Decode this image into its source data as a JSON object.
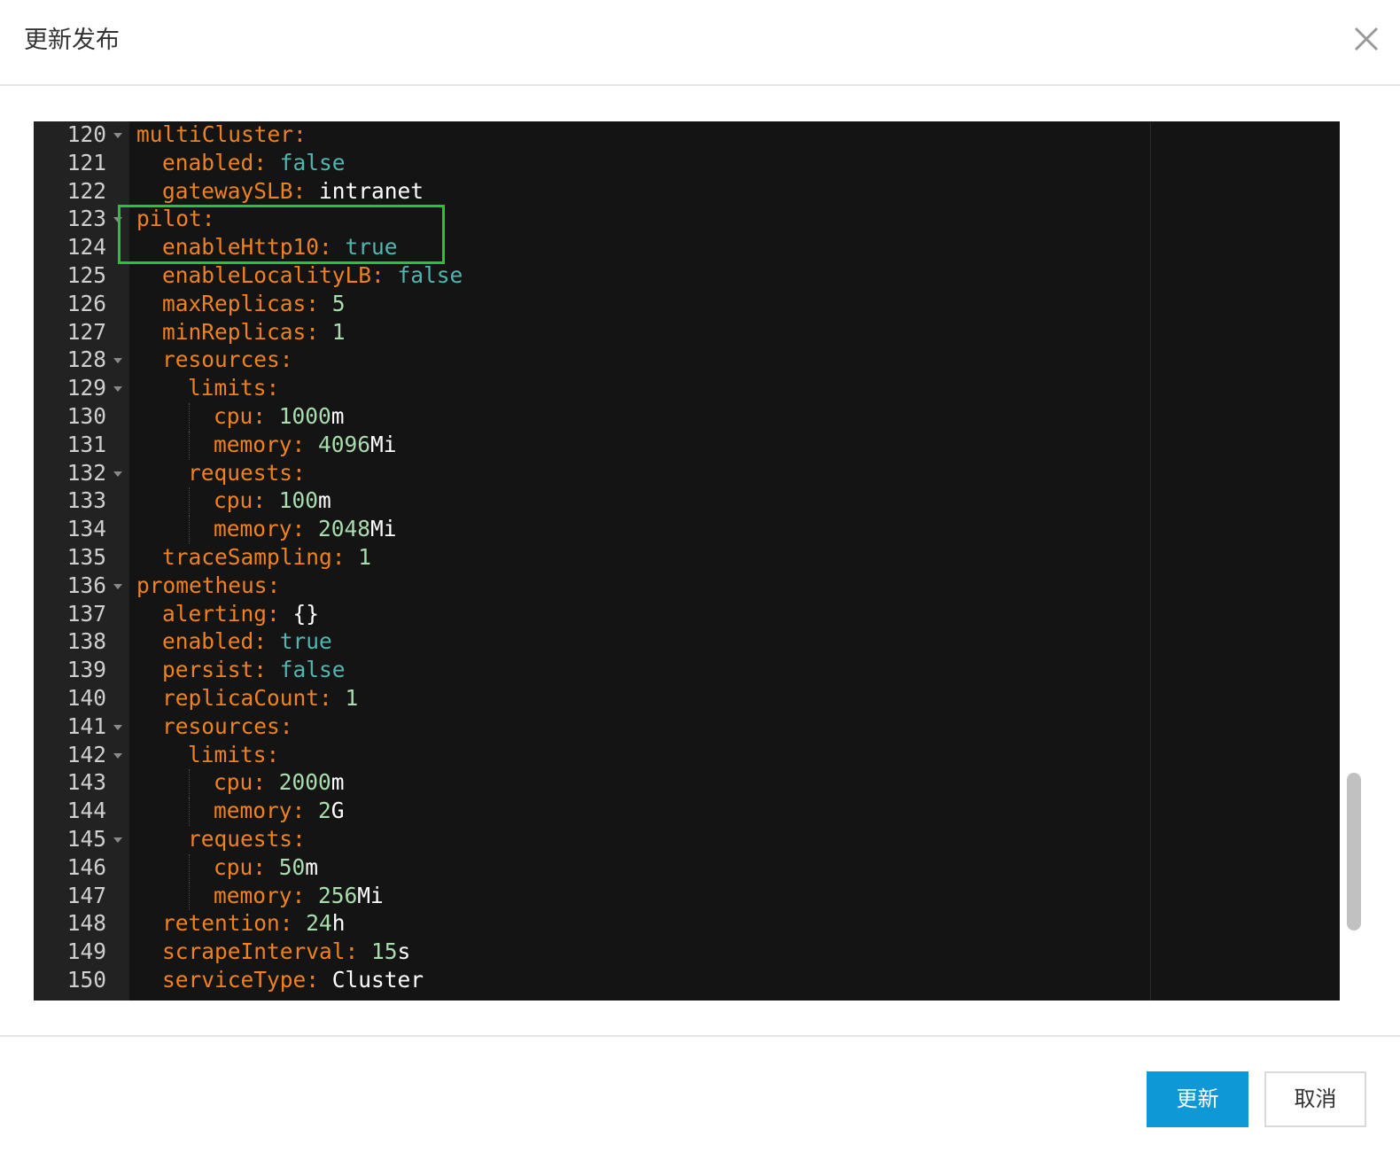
{
  "dialog": {
    "title": "更新发布",
    "close_icon": "close-icon"
  },
  "editor": {
    "lines": [
      {
        "num": "120",
        "fold": true,
        "indent": 0,
        "key": "multiCluster:",
        "value": "",
        "vtype": ""
      },
      {
        "num": "121",
        "fold": false,
        "indent": 1,
        "key": "enabled:",
        "value": "false",
        "vtype": "b"
      },
      {
        "num": "122",
        "fold": false,
        "indent": 1,
        "key": "gatewaySLB:",
        "value": "intranet",
        "vtype": "s"
      },
      {
        "num": "123",
        "fold": true,
        "indent": 0,
        "key": "pilot:",
        "value": "",
        "vtype": ""
      },
      {
        "num": "124",
        "fold": false,
        "indent": 1,
        "key": "enableHttp10:",
        "value": "true",
        "vtype": "b"
      },
      {
        "num": "125",
        "fold": false,
        "indent": 1,
        "key": "enableLocalityLB:",
        "value": "false",
        "vtype": "b"
      },
      {
        "num": "126",
        "fold": false,
        "indent": 1,
        "key": "maxReplicas:",
        "value": "5",
        "vtype": "n"
      },
      {
        "num": "127",
        "fold": false,
        "indent": 1,
        "key": "minReplicas:",
        "value": "1",
        "vtype": "n"
      },
      {
        "num": "128",
        "fold": true,
        "indent": 1,
        "key": "resources:",
        "value": "",
        "vtype": ""
      },
      {
        "num": "129",
        "fold": true,
        "indent": 2,
        "key": "limits:",
        "value": "",
        "vtype": ""
      },
      {
        "num": "130",
        "fold": false,
        "indent": 3,
        "key": "cpu:",
        "value": "1000",
        "unit": "m",
        "vtype": "n"
      },
      {
        "num": "131",
        "fold": false,
        "indent": 3,
        "key": "memory:",
        "value": "4096",
        "unit": "Mi",
        "vtype": "n"
      },
      {
        "num": "132",
        "fold": true,
        "indent": 2,
        "key": "requests:",
        "value": "",
        "vtype": ""
      },
      {
        "num": "133",
        "fold": false,
        "indent": 3,
        "key": "cpu:",
        "value": "100",
        "unit": "m",
        "vtype": "n"
      },
      {
        "num": "134",
        "fold": false,
        "indent": 3,
        "key": "memory:",
        "value": "2048",
        "unit": "Mi",
        "vtype": "n"
      },
      {
        "num": "135",
        "fold": false,
        "indent": 1,
        "key": "traceSampling:",
        "value": "1",
        "vtype": "n"
      },
      {
        "num": "136",
        "fold": true,
        "indent": 0,
        "key": "prometheus:",
        "value": "",
        "vtype": ""
      },
      {
        "num": "137",
        "fold": false,
        "indent": 1,
        "key": "alerting:",
        "value": "{}",
        "vtype": "s"
      },
      {
        "num": "138",
        "fold": false,
        "indent": 1,
        "key": "enabled:",
        "value": "true",
        "vtype": "b"
      },
      {
        "num": "139",
        "fold": false,
        "indent": 1,
        "key": "persist:",
        "value": "false",
        "vtype": "b"
      },
      {
        "num": "140",
        "fold": false,
        "indent": 1,
        "key": "replicaCount:",
        "value": "1",
        "vtype": "n"
      },
      {
        "num": "141",
        "fold": true,
        "indent": 1,
        "key": "resources:",
        "value": "",
        "vtype": ""
      },
      {
        "num": "142",
        "fold": true,
        "indent": 2,
        "key": "limits:",
        "value": "",
        "vtype": ""
      },
      {
        "num": "143",
        "fold": false,
        "indent": 3,
        "key": "cpu:",
        "value": "2000",
        "unit": "m",
        "vtype": "n"
      },
      {
        "num": "144",
        "fold": false,
        "indent": 3,
        "key": "memory:",
        "value": "2",
        "unit": "G",
        "vtype": "n"
      },
      {
        "num": "145",
        "fold": true,
        "indent": 2,
        "key": "requests:",
        "value": "",
        "vtype": ""
      },
      {
        "num": "146",
        "fold": false,
        "indent": 3,
        "key": "cpu:",
        "value": "50",
        "unit": "m",
        "vtype": "n"
      },
      {
        "num": "147",
        "fold": false,
        "indent": 3,
        "key": "memory:",
        "value": "256",
        "unit": "Mi",
        "vtype": "n"
      },
      {
        "num": "148",
        "fold": false,
        "indent": 1,
        "key": "retention:",
        "value": "24",
        "unit": "h",
        "vtype": "n"
      },
      {
        "num": "149",
        "fold": false,
        "indent": 1,
        "key": "scrapeInterval:",
        "value": "15",
        "unit": "s",
        "vtype": "n"
      },
      {
        "num": "150",
        "fold": false,
        "indent": 1,
        "key": "serviceType:",
        "value": "Cluster",
        "vtype": "s"
      }
    ],
    "colors": {
      "background": "#141414",
      "gutter": "#222222",
      "key": "#f0821e",
      "boolean": "#4fb6b0",
      "number": "#a9dcae",
      "string": "#ffffff",
      "highlight_box": "#22c82e"
    }
  },
  "footer": {
    "update_label": "更新",
    "cancel_label": "取消",
    "primary_color": "#0f98d6"
  }
}
